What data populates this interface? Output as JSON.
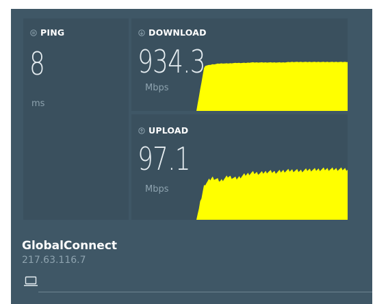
{
  "colors": {
    "panel": "#3f5766",
    "tile": "#3a505e",
    "graph_fill": "#ffff00",
    "value_text": "#e6edf1",
    "muted_text": "#8ea3af"
  },
  "ping": {
    "icon": "ping-icon",
    "label": "PING",
    "value": "8",
    "unit": "ms"
  },
  "download": {
    "icon": "download-arrow-icon",
    "label": "DOWNLOAD",
    "value": "934.3",
    "unit": "Mbps",
    "graph_samples": [
      0.0,
      0.9,
      0.93,
      0.95,
      0.95,
      0.96,
      0.96,
      0.97,
      0.97,
      0.97,
      0.97,
      0.97,
      0.98,
      0.98,
      0.98,
      0.98,
      0.98,
      0.98,
      0.98,
      0.98
    ]
  },
  "upload": {
    "icon": "upload-arrow-icon",
    "label": "UPLOAD",
    "value": "97.1",
    "unit": "Mbps",
    "graph_samples": [
      0.0,
      0.6,
      0.72,
      0.66,
      0.74,
      0.7,
      0.76,
      0.8,
      0.79,
      0.82,
      0.81,
      0.83,
      0.84,
      0.83,
      0.85,
      0.85,
      0.86,
      0.86,
      0.86,
      0.86
    ]
  },
  "server": {
    "name": "GlobalConnect",
    "ip": "217.63.116.7",
    "icon": "laptop-icon"
  }
}
